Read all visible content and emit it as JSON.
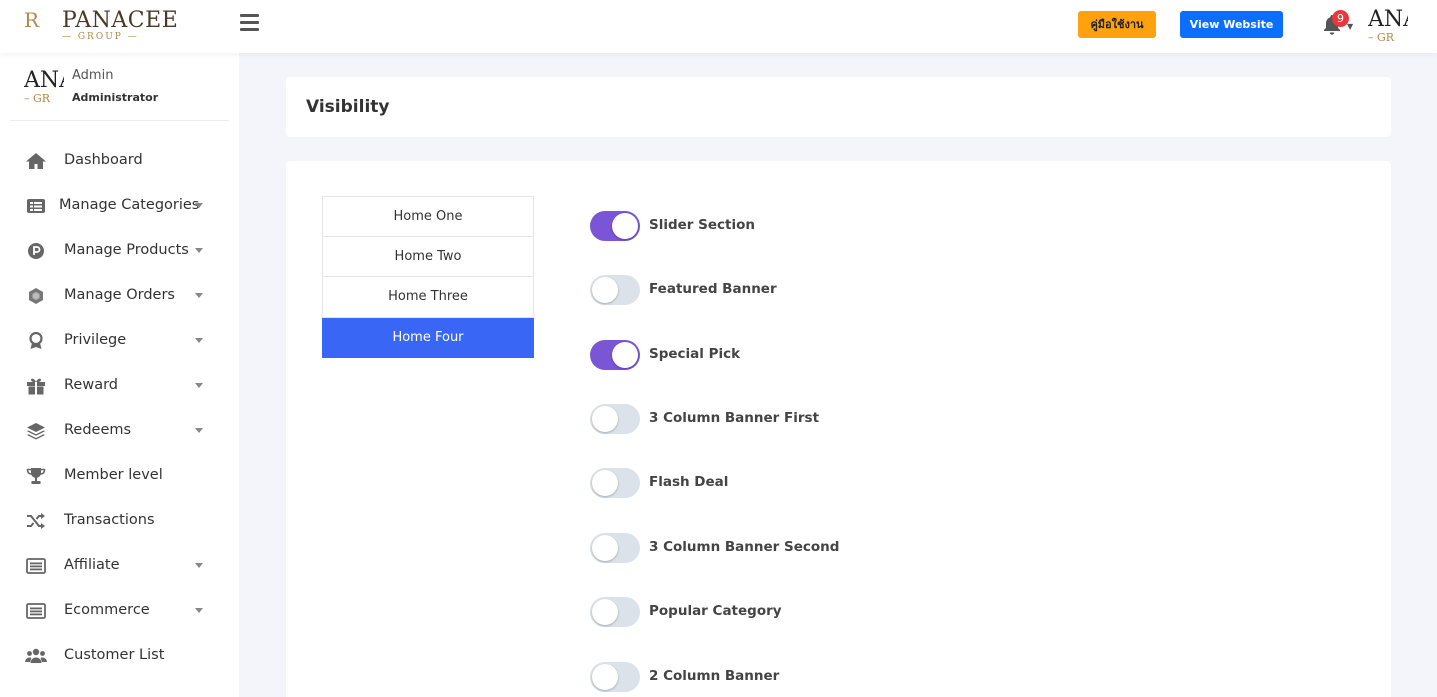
{
  "header": {
    "logo_text": "PANACEE",
    "logo_mark": "R",
    "logo_sub": "— GROUP —",
    "manual_button": "คู่มือใช้งาน",
    "view_website_button": "View Website",
    "notification_count": "9",
    "avatar_text": "ANA",
    "avatar_sub": "– GR"
  },
  "sidebar": {
    "user": {
      "avatar_text": "ANA",
      "avatar_sub": "– GR",
      "name": "Admin",
      "role": "Administrator"
    },
    "items": [
      {
        "label": "Dashboard",
        "icon": "home-icon",
        "has_caret": false
      },
      {
        "label": "Manage Categories",
        "icon": "list-icon",
        "has_caret": true
      },
      {
        "label": "Manage Products",
        "icon": "product-icon",
        "has_caret": true
      },
      {
        "label": "Manage Orders",
        "icon": "orders-icon",
        "has_caret": true
      },
      {
        "label": "Privilege",
        "icon": "award-icon",
        "has_caret": true
      },
      {
        "label": "Reward",
        "icon": "gift-icon",
        "has_caret": true
      },
      {
        "label": "Redeems",
        "icon": "layers-icon",
        "has_caret": true
      },
      {
        "label": "Member level",
        "icon": "trophy-icon",
        "has_caret": false
      },
      {
        "label": "Transactions",
        "icon": "shuffle-icon",
        "has_caret": false
      },
      {
        "label": "Affiliate",
        "icon": "list-alt-icon",
        "has_caret": true
      },
      {
        "label": "Ecommerce",
        "icon": "list-alt-icon",
        "has_caret": true
      },
      {
        "label": "Customer List",
        "icon": "users-icon",
        "has_caret": false
      }
    ]
  },
  "main": {
    "title": "Visibility",
    "home_tabs": [
      {
        "label": "Home One",
        "active": false
      },
      {
        "label": "Home Two",
        "active": false
      },
      {
        "label": "Home Three",
        "active": false
      },
      {
        "label": "Home Four",
        "active": true
      }
    ],
    "toggles": [
      {
        "label": "Slider Section",
        "on": true
      },
      {
        "label": "Featured Banner",
        "on": false
      },
      {
        "label": "Special Pick",
        "on": true
      },
      {
        "label": "3 Column Banner First",
        "on": false
      },
      {
        "label": "Flash Deal",
        "on": false
      },
      {
        "label": "3 Column Banner Second",
        "on": false
      },
      {
        "label": "Popular Category",
        "on": false
      },
      {
        "label": "2 Column Banner",
        "on": false
      }
    ]
  },
  "colors": {
    "accent": "#3a66f6",
    "toggle_on": "#7a55d6",
    "toggle_off": "#dce2ea",
    "manual_button": "#ffa20e",
    "view_button": "#0d6efd",
    "badge": "#e8373d"
  }
}
